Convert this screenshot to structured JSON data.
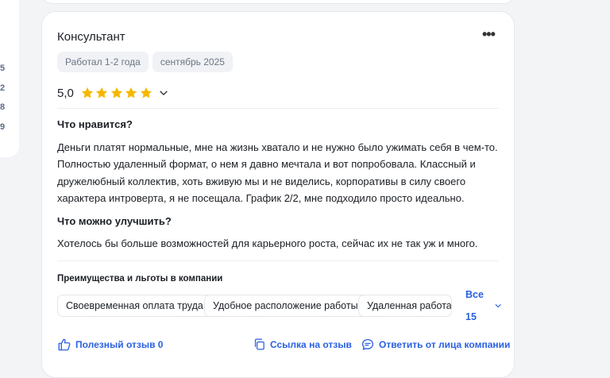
{
  "sidebar": {
    "numbers": [
      "5",
      "2",
      "8",
      "9"
    ]
  },
  "review": {
    "position": "Консультант",
    "tags": [
      "Работал 1-2 года",
      "сентябрь 2025"
    ],
    "rating": "5,0",
    "stars": 5,
    "likes_heading": "Что нравится?",
    "likes_text": "Деньги платят нормальные, мне на жизнь хватало и не нужно было ужимать себя в чем-то. Полностью удаленный формат, о нем я давно мечтала и вот попробовала. Классный и дружелюбный коллектив, хоть вживую мы и не виделись, корпоративы в силу своего характера интроверта, я не посещала. График 2/2, мне подходило просто идеально.",
    "improve_heading": "Что можно улучшить?",
    "improve_text": "Хотелось бы больше возможностей для карьерного роста, сейчас их не так уж и много.",
    "benefits_heading": "Преимущества и льготы в компании",
    "benefits": [
      "Своевременная оплата труда",
      "Удобное расположение работы",
      "Удаленная работа"
    ],
    "benefits_all": "Все 15",
    "actions": {
      "helpful": "Полезный отзыв 0",
      "link": "Ссылка на отзыв",
      "reply": "Ответить от лица компании"
    }
  },
  "colors": {
    "accent": "#2b61e0",
    "star": "#f5b800",
    "chip_bg": "#f0f2f5"
  },
  "icons": [
    "more-icon",
    "star-icon",
    "chevron-down-icon",
    "thumbs-up-icon",
    "copy-link-icon",
    "chat-reply-icon"
  ]
}
